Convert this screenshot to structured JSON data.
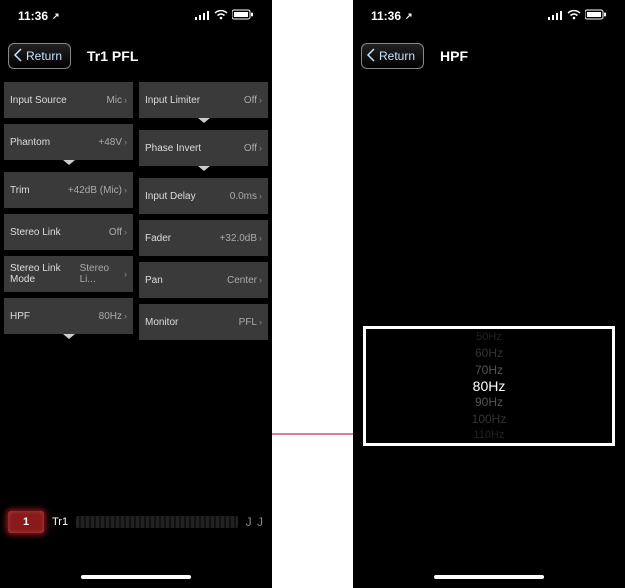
{
  "status": {
    "time": "11:36",
    "location_arrow": "↗"
  },
  "left": {
    "return": "Return",
    "title": "Tr1 PFL",
    "colA": [
      {
        "label": "Input Source",
        "value": "Mic",
        "expand": false
      },
      {
        "label": "Phantom",
        "value": "+48V",
        "expand": true
      },
      {
        "label": "Trim",
        "value": "+42dB (Mic)",
        "expand": false
      },
      {
        "label": "Stereo Link",
        "value": "Off",
        "expand": false
      },
      {
        "label": "Stereo Link Mode",
        "value": "Stereo Li...",
        "expand": false
      },
      {
        "label": "HPF",
        "value": "80Hz",
        "expand": true
      }
    ],
    "colB": [
      {
        "label": "Input Limiter",
        "value": "Off",
        "expand": true
      },
      {
        "label": "Phase Invert",
        "value": "Off",
        "expand": true
      },
      {
        "label": "Input Delay",
        "value": "0.0ms",
        "expand": false
      },
      {
        "label": "Fader",
        "value": "+32.0dB",
        "expand": false
      },
      {
        "label": "Pan",
        "value": "Center",
        "expand": false
      },
      {
        "label": "Monitor",
        "value": "PFL",
        "expand": false
      }
    ],
    "track": {
      "num": "1",
      "name": "Tr1",
      "jj": "J J"
    }
  },
  "right": {
    "return": "Return",
    "title": "HPF",
    "picker": [
      "50Hz",
      "60Hz",
      "70Hz",
      "80Hz",
      "90Hz",
      "100Hz",
      "110Hz"
    ],
    "picker_selected": "80Hz"
  }
}
